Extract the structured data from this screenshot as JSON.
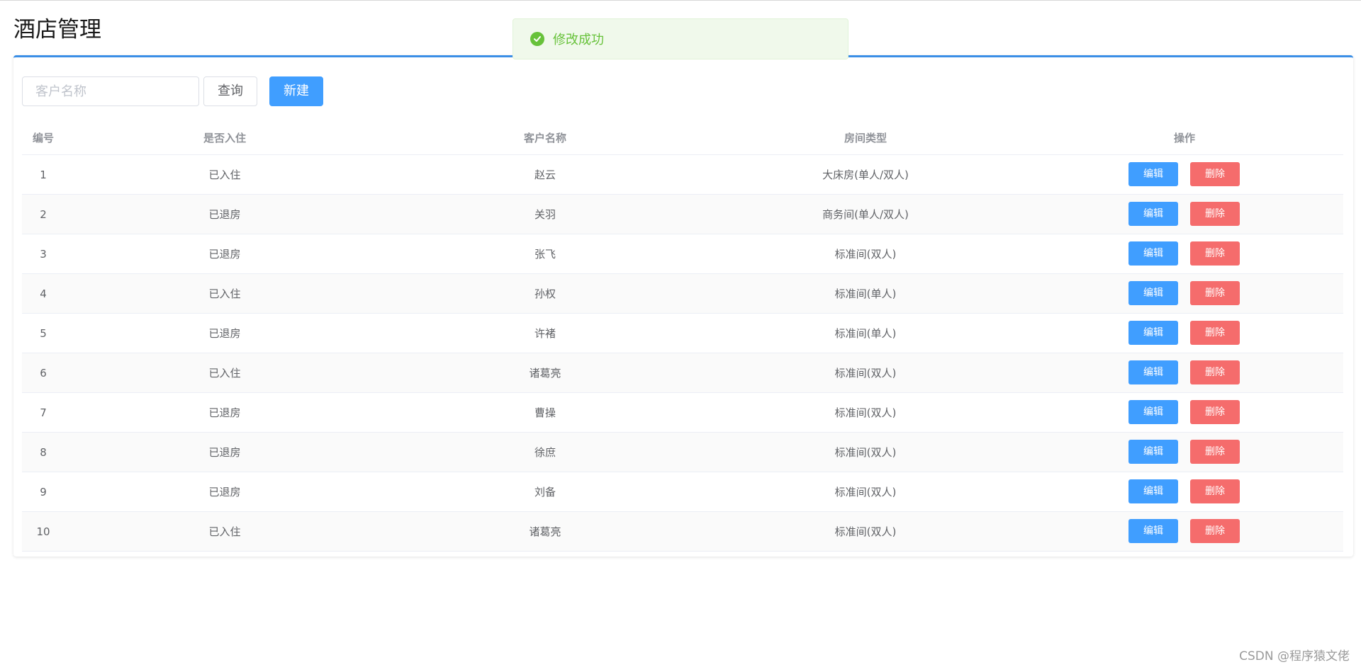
{
  "header": {
    "title": "酒店管理"
  },
  "toolbar": {
    "search_placeholder": "客户名称",
    "search_value": "",
    "query_label": "查询",
    "new_label": "新建"
  },
  "table": {
    "columns": [
      "编号",
      "是否入住",
      "客户名称",
      "房间类型",
      "操作"
    ],
    "rows": [
      {
        "id": "1",
        "status": "已入住",
        "name": "赵云",
        "room": "大床房(单人/双人)"
      },
      {
        "id": "2",
        "status": "已退房",
        "name": "关羽",
        "room": "商务间(单人/双人)"
      },
      {
        "id": "3",
        "status": "已退房",
        "name": "张飞",
        "room": "标准间(双人)"
      },
      {
        "id": "4",
        "status": "已入住",
        "name": "孙权",
        "room": "标准间(单人)"
      },
      {
        "id": "5",
        "status": "已退房",
        "name": "许褚",
        "room": "标准间(单人)"
      },
      {
        "id": "6",
        "status": "已入住",
        "name": "诸葛亮",
        "room": "标准间(双人)"
      },
      {
        "id": "7",
        "status": "已退房",
        "name": "曹操",
        "room": "标准间(双人)"
      },
      {
        "id": "8",
        "status": "已退房",
        "name": "徐庶",
        "room": "标准间(双人)"
      },
      {
        "id": "9",
        "status": "已退房",
        "name": "刘备",
        "room": "标准间(双人)"
      },
      {
        "id": "10",
        "status": "已入住",
        "name": "诸葛亮",
        "room": "标准间(双人)"
      }
    ],
    "edit_label": "编辑",
    "delete_label": "删除"
  },
  "toast": {
    "message": "修改成功",
    "icon": "check-circle-icon"
  },
  "watermark": "CSDN @程序猿文佬",
  "colors": {
    "primary": "#409eff",
    "danger": "#f56c6c",
    "success": "#67c23a",
    "header_border": "#3a8ee6"
  }
}
